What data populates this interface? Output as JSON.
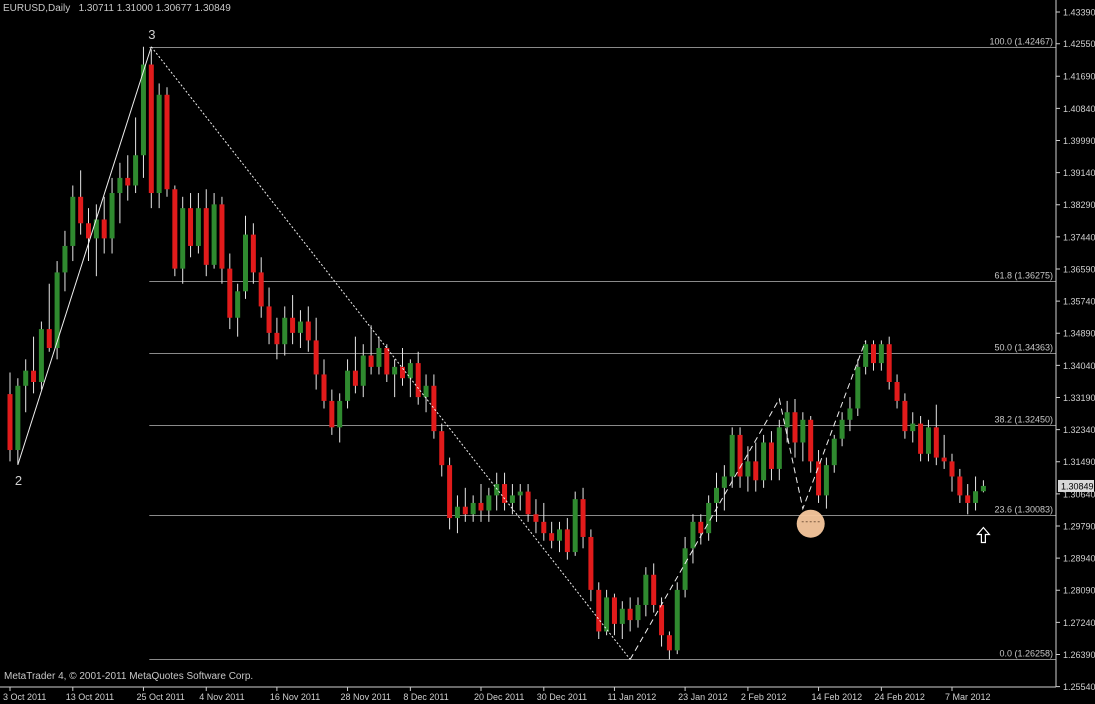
{
  "header": {
    "symbol": "EURUSD,Daily",
    "ohlc": "1.30711 1.31000 1.30677 1.30849"
  },
  "footer": {
    "copyright": "MetaTrader 4, © 2001-2011 MetaQuotes Software Corp."
  },
  "colors": {
    "background": "#000000",
    "bull_candle": "#2f8a2f",
    "bear_candle": "#e11b1b",
    "wick": "#e6e6e6",
    "fib_line": "#b8b8b8",
    "highlight_circle": "#f7c79d",
    "price_tag_bg": "#d8d8d8"
  },
  "icons": {
    "signal_arrow": "up-arrow-icon",
    "highlight": "highlight-circle-icon"
  },
  "chart_data": {
    "type": "candlestick",
    "symbol": "EURUSD",
    "timeframe": "Daily",
    "ylim": [
      1.2553,
      1.4339
    ],
    "y_ticks": [
      "1.43390",
      "1.42550",
      "1.41690",
      "1.40840",
      "1.39990",
      "1.39140",
      "1.38290",
      "1.37440",
      "1.36590",
      "1.35740",
      "1.34890",
      "1.34040",
      "1.33190",
      "1.32340",
      "1.31490",
      "1.30640",
      "1.29790",
      "1.28940",
      "1.28090",
      "1.27240",
      "1.26390",
      "1.25540"
    ],
    "x_ticks": [
      "3 Oct 2011",
      "13 Oct 2011",
      "25 Oct 2011",
      "4 Nov 2011",
      "16 Nov 2011",
      "28 Nov 2011",
      "8 Dec 2011",
      "20 Dec 2011",
      "30 Dec 2011",
      "11 Jan 2012",
      "23 Jan 2012",
      "2 Feb 2012",
      "14 Feb 2012",
      "24 Feb 2012",
      "7 Mar 2012"
    ],
    "x_tick_index": [
      0,
      8,
      17,
      25,
      34,
      43,
      51,
      60,
      68,
      77,
      86,
      94,
      103,
      111,
      120
    ],
    "current_price": "1.30849",
    "fibonacci": {
      "from_index": 18,
      "levels": [
        {
          "label": "100.0 (1.42467)",
          "price": 1.42467
        },
        {
          "label": "61.8 (1.36275)",
          "price": 1.36275
        },
        {
          "label": "50.0 (1.34363)",
          "price": 1.34363
        },
        {
          "label": "38.2 (1.32450)",
          "price": 1.3245
        },
        {
          "label": "23.6 (1.30083)",
          "price": 1.30083
        },
        {
          "label": "0.0 (1.26258)",
          "price": 1.26258
        }
      ]
    },
    "wave_labels": [
      {
        "text": "2",
        "index": 1,
        "price": 1.3141
      },
      {
        "text": "3",
        "index": 18,
        "price": 1.4247
      }
    ],
    "wave_lines": [
      {
        "style": "solid",
        "points": [
          [
            1,
            1.3141
          ],
          [
            18,
            1.4247
          ]
        ]
      },
      {
        "style": "dotted",
        "points": [
          [
            18,
            1.4247
          ],
          [
            79,
            1.2626
          ]
        ]
      },
      {
        "style": "dashed",
        "points": [
          [
            79,
            1.2626
          ],
          [
            98,
            1.3315
          ],
          [
            101,
            1.3025
          ],
          [
            109,
            1.347
          ]
        ]
      }
    ],
    "highlight": {
      "index": 102,
      "price": 1.2985
    },
    "signal_arrow": {
      "index": 124,
      "price": 1.2975
    },
    "candles": [
      [
        1.3328,
        1.3385,
        1.315,
        1.318
      ],
      [
        1.318,
        1.337,
        1.3141,
        1.335
      ],
      [
        1.335,
        1.342,
        1.328,
        1.339
      ],
      [
        1.339,
        1.348,
        1.333,
        1.336
      ],
      [
        1.336,
        1.352,
        1.334,
        1.35
      ],
      [
        1.35,
        1.362,
        1.344,
        1.345
      ],
      [
        1.345,
        1.368,
        1.342,
        1.365
      ],
      [
        1.365,
        1.376,
        1.36,
        1.372
      ],
      [
        1.372,
        1.388,
        1.368,
        1.385
      ],
      [
        1.385,
        1.392,
        1.375,
        1.378
      ],
      [
        1.378,
        1.382,
        1.368,
        1.374
      ],
      [
        1.374,
        1.383,
        1.364,
        1.379
      ],
      [
        1.379,
        1.385,
        1.37,
        1.374
      ],
      [
        1.374,
        1.39,
        1.37,
        1.386
      ],
      [
        1.386,
        1.394,
        1.378,
        1.39
      ],
      [
        1.39,
        1.396,
        1.384,
        1.388
      ],
      [
        1.388,
        1.406,
        1.386,
        1.396
      ],
      [
        1.396,
        1.4247,
        1.39,
        1.42
      ],
      [
        1.42,
        1.424,
        1.382,
        1.386
      ],
      [
        1.386,
        1.415,
        1.382,
        1.412
      ],
      [
        1.412,
        1.414,
        1.385,
        1.387
      ],
      [
        1.387,
        1.388,
        1.364,
        1.366
      ],
      [
        1.366,
        1.385,
        1.362,
        1.382
      ],
      [
        1.382,
        1.386,
        1.369,
        1.372
      ],
      [
        1.372,
        1.386,
        1.37,
        1.382
      ],
      [
        1.382,
        1.387,
        1.364,
        1.367
      ],
      [
        1.367,
        1.386,
        1.366,
        1.383
      ],
      [
        1.383,
        1.385,
        1.362,
        1.366
      ],
      [
        1.366,
        1.37,
        1.35,
        1.353
      ],
      [
        1.353,
        1.362,
        1.348,
        1.36
      ],
      [
        1.36,
        1.38,
        1.358,
        1.375
      ],
      [
        1.375,
        1.378,
        1.362,
        1.365
      ],
      [
        1.365,
        1.369,
        1.353,
        1.356
      ],
      [
        1.356,
        1.361,
        1.346,
        1.349
      ],
      [
        1.349,
        1.353,
        1.342,
        1.346
      ],
      [
        1.346,
        1.356,
        1.343,
        1.353
      ],
      [
        1.353,
        1.359,
        1.346,
        1.349
      ],
      [
        1.349,
        1.355,
        1.345,
        1.352
      ],
      [
        1.352,
        1.356,
        1.344,
        1.347
      ],
      [
        1.347,
        1.353,
        1.334,
        1.338
      ],
      [
        1.338,
        1.342,
        1.329,
        1.331
      ],
      [
        1.331,
        1.334,
        1.322,
        1.324
      ],
      [
        1.324,
        1.333,
        1.32,
        1.331
      ],
      [
        1.331,
        1.342,
        1.329,
        1.339
      ],
      [
        1.339,
        1.348,
        1.333,
        1.335
      ],
      [
        1.335,
        1.346,
        1.332,
        1.343
      ],
      [
        1.343,
        1.351,
        1.338,
        1.34
      ],
      [
        1.34,
        1.348,
        1.338,
        1.345
      ],
      [
        1.345,
        1.346,
        1.336,
        1.338
      ],
      [
        1.338,
        1.342,
        1.332,
        1.34
      ],
      [
        1.34,
        1.345,
        1.335,
        1.337
      ],
      [
        1.337,
        1.342,
        1.332,
        1.341
      ],
      [
        1.341,
        1.344,
        1.33,
        1.332
      ],
      [
        1.332,
        1.338,
        1.328,
        1.335
      ],
      [
        1.335,
        1.338,
        1.321,
        1.323
      ],
      [
        1.323,
        1.325,
        1.311,
        1.314
      ],
      [
        1.314,
        1.316,
        1.297,
        1.3
      ],
      [
        1.3,
        1.306,
        1.296,
        1.303
      ],
      [
        1.303,
        1.308,
        1.299,
        1.301
      ],
      [
        1.301,
        1.306,
        1.299,
        1.304
      ],
      [
        1.304,
        1.309,
        1.299,
        1.302
      ],
      [
        1.302,
        1.308,
        1.299,
        1.306
      ],
      [
        1.306,
        1.312,
        1.302,
        1.309
      ],
      [
        1.309,
        1.312,
        1.302,
        1.304
      ],
      [
        1.304,
        1.309,
        1.301,
        1.306
      ],
      [
        1.306,
        1.309,
        1.302,
        1.307
      ],
      [
        1.307,
        1.309,
        1.299,
        1.301
      ],
      [
        1.301,
        1.305,
        1.296,
        1.299
      ],
      [
        1.299,
        1.304,
        1.294,
        1.296
      ],
      [
        1.296,
        1.299,
        1.292,
        1.294
      ],
      [
        1.294,
        1.299,
        1.291,
        1.297
      ],
      [
        1.297,
        1.3,
        1.289,
        1.291
      ],
      [
        1.291,
        1.307,
        1.29,
        1.305
      ],
      [
        1.305,
        1.308,
        1.292,
        1.295
      ],
      [
        1.295,
        1.297,
        1.278,
        1.281
      ],
      [
        1.281,
        1.283,
        1.268,
        1.27
      ],
      [
        1.27,
        1.281,
        1.269,
        1.279
      ],
      [
        1.279,
        1.28,
        1.269,
        1.272
      ],
      [
        1.272,
        1.278,
        1.268,
        1.276
      ],
      [
        1.276,
        1.279,
        1.27,
        1.273
      ],
      [
        1.273,
        1.279,
        1.271,
        1.277
      ],
      [
        1.277,
        1.287,
        1.274,
        1.285
      ],
      [
        1.285,
        1.288,
        1.275,
        1.277
      ],
      [
        1.277,
        1.279,
        1.266,
        1.269
      ],
      [
        1.269,
        1.27,
        1.2626,
        1.265
      ],
      [
        1.265,
        1.283,
        1.264,
        1.281
      ],
      [
        1.281,
        1.295,
        1.279,
        1.292
      ],
      [
        1.292,
        1.301,
        1.288,
        1.299
      ],
      [
        1.299,
        1.301,
        1.293,
        1.296
      ],
      [
        1.296,
        1.306,
        1.294,
        1.304
      ],
      [
        1.304,
        1.312,
        1.299,
        1.308
      ],
      [
        1.308,
        1.314,
        1.302,
        1.311
      ],
      [
        1.311,
        1.324,
        1.308,
        1.322
      ],
      [
        1.322,
        1.324,
        1.308,
        1.311
      ],
      [
        1.311,
        1.319,
        1.307,
        1.315
      ],
      [
        1.315,
        1.32,
        1.307,
        1.31
      ],
      [
        1.31,
        1.322,
        1.308,
        1.32
      ],
      [
        1.32,
        1.323,
        1.31,
        1.313
      ],
      [
        1.313,
        1.326,
        1.31,
        1.324
      ],
      [
        1.324,
        1.331,
        1.32,
        1.328
      ],
      [
        1.328,
        1.3315,
        1.316,
        1.32
      ],
      [
        1.32,
        1.328,
        1.315,
        1.326
      ],
      [
        1.326,
        1.327,
        1.312,
        1.315
      ],
      [
        1.315,
        1.318,
        1.304,
        1.306
      ],
      [
        1.306,
        1.316,
        1.3025,
        1.314
      ],
      [
        1.314,
        1.322,
        1.312,
        1.321
      ],
      [
        1.321,
        1.328,
        1.319,
        1.326
      ],
      [
        1.326,
        1.332,
        1.323,
        1.329
      ],
      [
        1.329,
        1.342,
        1.327,
        1.34
      ],
      [
        1.34,
        1.347,
        1.338,
        1.346
      ],
      [
        1.346,
        1.347,
        1.339,
        1.341
      ],
      [
        1.341,
        1.347,
        1.339,
        1.346
      ],
      [
        1.346,
        1.348,
        1.334,
        1.336
      ],
      [
        1.336,
        1.338,
        1.329,
        1.331
      ],
      [
        1.331,
        1.333,
        1.321,
        1.323
      ],
      [
        1.323,
        1.328,
        1.32,
        1.325
      ],
      [
        1.325,
        1.327,
        1.315,
        1.317
      ],
      [
        1.317,
        1.326,
        1.315,
        1.324
      ],
      [
        1.324,
        1.33,
        1.314,
        1.316
      ],
      [
        1.316,
        1.322,
        1.313,
        1.315
      ],
      [
        1.315,
        1.317,
        1.307,
        1.311
      ],
      [
        1.311,
        1.313,
        1.304,
        1.306
      ],
      [
        1.306,
        1.309,
        1.301,
        1.304
      ],
      [
        1.304,
        1.311,
        1.302,
        1.3071
      ],
      [
        1.3071,
        1.31,
        1.3068,
        1.3085
      ]
    ]
  }
}
